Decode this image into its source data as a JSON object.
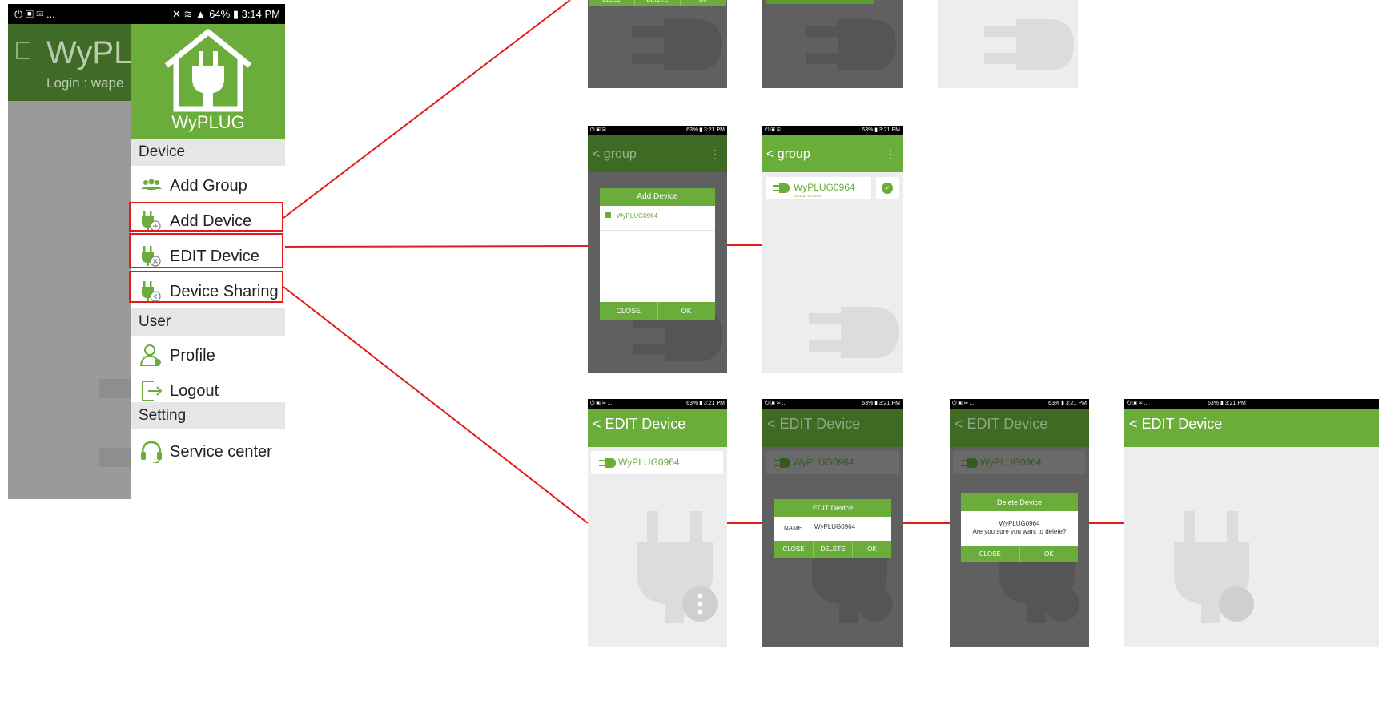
{
  "phone": {
    "status_left_icons": "⏻  ▣ ✉ ...",
    "status_right": "64% ▮ 3:14 PM",
    "app_title": "WyPLU",
    "login_text": "Login : wape",
    "brand": "WyPLUG",
    "sections": {
      "device": "Device",
      "user": "User",
      "setting": "Setting"
    },
    "menu": {
      "add_group": "Add Group",
      "add_device": "Add Device",
      "edit_device": "EDIT Device",
      "device_sharing": "Device Sharing",
      "profile": "Profile",
      "logout": "Logout",
      "service_center": "Service center"
    }
  },
  "small_status": {
    "left": "⏻  ▣ ✉ ...",
    "right": "63% ▮ 3:21 PM"
  },
  "top_row": {
    "btn_close": "CLOSE",
    "btn_delete": "DELETE",
    "btn_ok": "OK"
  },
  "group_screens": {
    "title": "group",
    "dialog_title": "Add Device",
    "dialog_item": "WyPLUG0964",
    "btn_close": "CLOSE",
    "btn_ok": "OK",
    "device_name": "WyPLUG0964",
    "device_sub": "00:1D:A7:0D:09:64"
  },
  "edit_screens": {
    "title": "EDIT Device",
    "device_name": "WyPLUG0964",
    "edit_dialog_title": "EDIT Device",
    "name_label": "NAME",
    "name_value": "WyPLUG0964",
    "btn_close": "CLOSE",
    "btn_delete": "DELETE",
    "btn_ok": "OK",
    "delete_dialog_title": "Delete Device",
    "delete_line1": "WyPLUG0964",
    "delete_line2": "Are you sure you want to delete?"
  },
  "colors": {
    "accent": "#6aad3b",
    "connector": "#e31b1b"
  }
}
